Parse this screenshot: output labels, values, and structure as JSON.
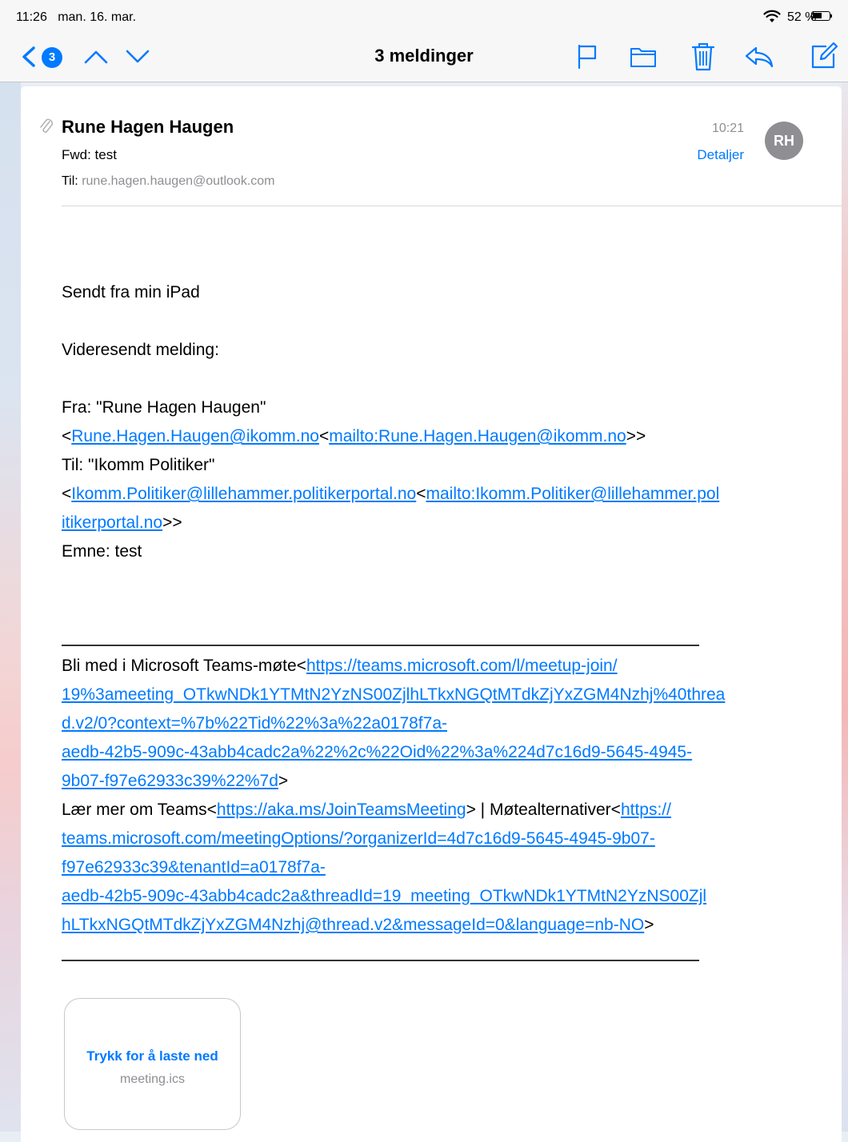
{
  "status_bar": {
    "time": "11:26",
    "date": "man. 16. mar.",
    "battery_percent": "52 %",
    "battery_level": 0.52
  },
  "nav": {
    "title": "3 meldinger",
    "back_count": "3",
    "accent_color": "#007aff"
  },
  "mail": {
    "sender": "Rune Hagen Haugen",
    "subject": "Fwd: test",
    "to_label": "Til:",
    "to_address": "rune.hagen.haugen@outlook.com",
    "time": "10:21",
    "details_label": "Detaljer",
    "avatar_initials": "RH"
  },
  "body": {
    "sent_from": "Sendt fra min iPad",
    "forwarded_header": "Videresendt melding:",
    "from_line": "Fra: \"Rune Hagen Haugen\"",
    "from_addr_prefix": "<",
    "from_addr_link": "Rune.Hagen.Haugen@ikomm.no",
    "from_addr_mid": "<",
    "from_mailto_link": "mailto:Rune.Hagen.Haugen@ikomm.no",
    "from_addr_suffix": ">>",
    "to_line": "Til: \"Ikomm Politiker\"",
    "to_addr_prefix": "<",
    "to_addr_link": "Ikomm.Politiker@lillehammer.politikerportal.no",
    "to_addr_mid": "<",
    "to_mailto_link_1": "mailto:Ikomm.Politiker@lillehammer.pol",
    "to_mailto_link_2": "itikerportal.no",
    "to_addr_suffix": ">>",
    "subject_line": "Emne: test",
    "teams_join_prefix": "Bli med i Microsoft Teams-møte<",
    "teams_join_link_1": "https://teams.microsoft.com/l/meetup-join/",
    "teams_join_link_2": "19%3ameeting_OTkwNDk1YTMtN2YzNS00ZjlhLTkxNGQtMTdkZjYxZGM4Nzhj%40threa",
    "teams_join_link_3": "d.v2/0?context=%7b%22Tid%22%3a%22a0178f7a-",
    "teams_join_link_4": "aedb-42b5-909c-43abb4cadc2a%22%2c%22Oid%22%3a%224d7c16d9-5645-4945-",
    "teams_join_link_5": "9b07-f97e62933c39%22%7d",
    "teams_join_suffix": ">",
    "learn_prefix": "Lær mer om Teams<",
    "learn_link": "https://aka.ms/JoinTeamsMeeting",
    "learn_mid": "> | Møtealternativer<",
    "options_link_1": "https://",
    "options_link_2": "teams.microsoft.com/meetingOptions/?organizerId=4d7c16d9-5645-4945-9b07-",
    "options_link_3": "f97e62933c39&tenantId=a0178f7a-",
    "options_link_4": "aedb-42b5-909c-43abb4cadc2a&threadId=19_meeting_OTkwNDk1YTMtN2YzNS00Zjl",
    "options_link_5": "hLTkxNGQtMTdkZjYxZGM4Nzhj@thread.v2&messageId=0&language=nb-NO",
    "options_suffix": ">"
  },
  "attachment": {
    "action_label": "Trykk for å laste ned",
    "filename": "meeting.ics"
  }
}
